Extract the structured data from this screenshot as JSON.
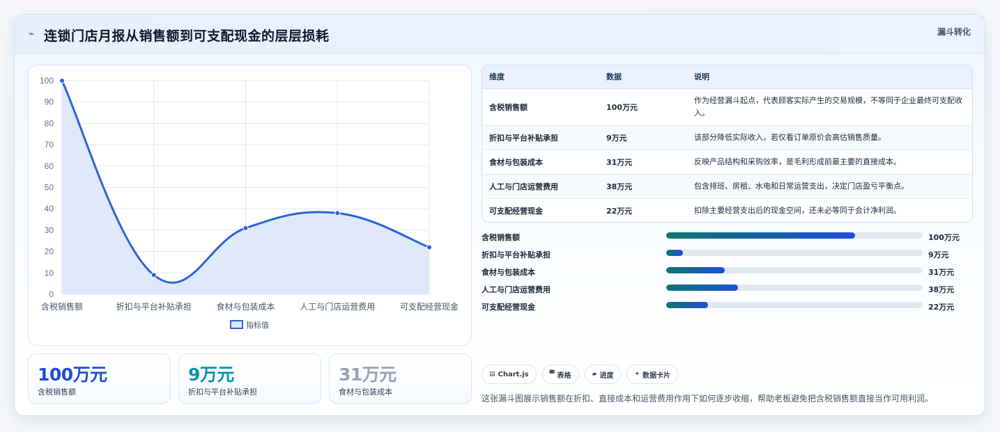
{
  "header": {
    "icon": "chart-line-icon",
    "title": "连锁门店月报从销售额到可支配现金的层层损耗",
    "tag": "漏斗转化"
  },
  "chart_data": {
    "type": "line",
    "categories": [
      "含税销售额",
      "折扣与平台补贴承担",
      "食材与包装成本",
      "人工与门店运营费用",
      "可支配经营现金"
    ],
    "series": [
      {
        "name": "指标值",
        "values": [
          100,
          9,
          31,
          38,
          22
        ]
      }
    ],
    "yticks": [
      "0",
      "10",
      "20",
      "30",
      "40",
      "50",
      "60",
      "70",
      "80",
      "90",
      "100"
    ],
    "ylim": [
      0,
      100
    ],
    "xlabel": "",
    "ylabel": "",
    "grid": true,
    "legend": "bottom",
    "color": "#2c62d8",
    "fill": "#dce7fb"
  },
  "stats": [
    {
      "value": "100万元",
      "label": "含税销售额",
      "color": "#1d4ed8"
    },
    {
      "value": "9万元",
      "label": "折扣与平台补贴承担",
      "color": "#0891b2"
    },
    {
      "value": "31万元",
      "label": "食材与包装成本",
      "color": "#94a3b8"
    }
  ],
  "table": {
    "headers": [
      "维度",
      "数据",
      "说明"
    ],
    "rows": [
      [
        "含税销售额",
        "100万元",
        "作为经营漏斗起点，代表顾客实际产生的交易规模，不等同于企业最终可支配收入。"
      ],
      [
        "折扣与平台补贴承担",
        "9万元",
        "该部分降低实际收入，若仅看订单原价会高估销售质量。"
      ],
      [
        "食材与包装成本",
        "31万元",
        "反映产品结构和采购效率，是毛利形成前最主要的直接成本。"
      ],
      [
        "人工与门店运营费用",
        "38万元",
        "包含排班、房租、水电和日常运营支出，决定门店盈亏平衡点。"
      ],
      [
        "可支配经营现金",
        "22万元",
        "扣除主要经营支出后的现金空间，还未必等同于会计净利润。"
      ]
    ]
  },
  "progress": [
    {
      "label": "含税销售额",
      "value": 100,
      "display": "100万元"
    },
    {
      "label": "折扣与平台补贴承担",
      "value": 9,
      "display": "9万元"
    },
    {
      "label": "食材与包装成本",
      "value": 31,
      "display": "31万元"
    },
    {
      "label": "人工与门店运营费用",
      "value": 38,
      "display": "38万元"
    },
    {
      "label": "可支配经营现金",
      "value": 22,
      "display": "22万元"
    }
  ],
  "progress_max": 136,
  "badges": [
    {
      "icon": "▤",
      "label": "Chart.js"
    },
    {
      "icon": "▀",
      "label": "表格"
    },
    {
      "icon": "▰",
      "label": "进度"
    },
    {
      "icon": "✦",
      "label": "数据卡片"
    }
  ],
  "footnote": "这张漏斗图展示销售额在折扣、直接成本和运营费用作用下如何逐步收缩，帮助老板避免把含税销售额直接当作可用利润。"
}
